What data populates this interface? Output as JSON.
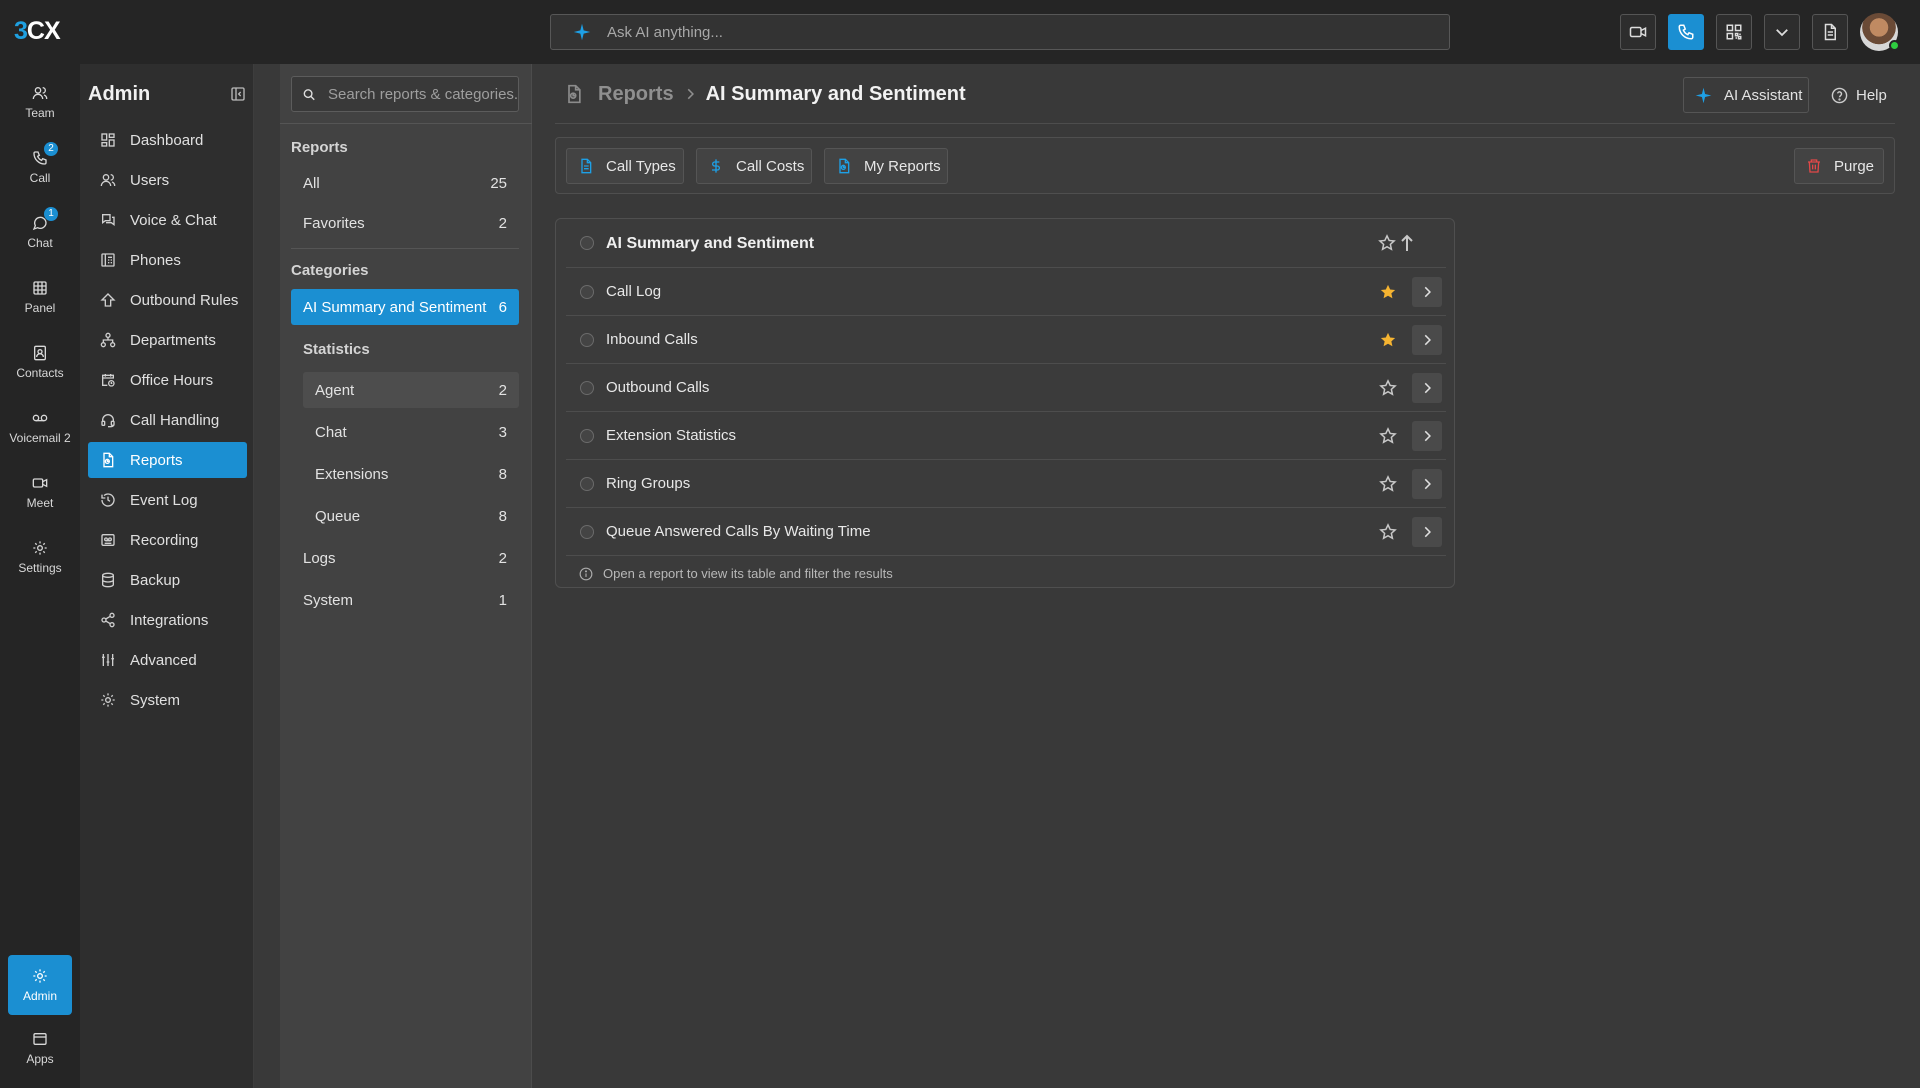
{
  "top": {
    "logo_3": "3",
    "logo_cx": "CX",
    "ai_placeholder": "Ask AI anything...",
    "buttons": [
      "video-icon",
      "phone-icon",
      "qr-code-icon",
      "chevron-down-icon",
      "document-icon"
    ]
  },
  "rail": [
    {
      "label": "Team",
      "icon": "team-icon"
    },
    {
      "label": "Call",
      "icon": "phone-icon",
      "badge": "2"
    },
    {
      "label": "Chat",
      "icon": "chat-icon",
      "badge": "1"
    },
    {
      "label": "Panel",
      "icon": "grid-icon"
    },
    {
      "label": "Contacts",
      "icon": "contacts-icon"
    },
    {
      "label": "Voicemail 2",
      "icon": "voicemail-icon"
    },
    {
      "label": "Meet",
      "icon": "video-icon"
    },
    {
      "label": "Settings",
      "icon": "gear-icon"
    },
    {
      "label": "Admin",
      "icon": "admin-gear-icon"
    },
    {
      "label": "Apps",
      "icon": "apps-icon"
    }
  ],
  "admin": {
    "title": "Admin",
    "items": [
      "Dashboard",
      "Users",
      "Voice & Chat",
      "Phones",
      "Outbound Rules",
      "Departments",
      "Office Hours",
      "Call Handling",
      "Reports",
      "Event Log",
      "Recording",
      "Backup",
      "Integrations",
      "Advanced",
      "System"
    ],
    "active": "Reports"
  },
  "categories": {
    "search_placeholder": "Search reports & categories...",
    "reports_label": "Reports",
    "all": {
      "label": "All",
      "count": "25"
    },
    "favorites": {
      "label": "Favorites",
      "count": "2"
    },
    "categories_label": "Categories",
    "ai_summary": {
      "label": "AI Summary and Sentiment",
      "count": "6"
    },
    "statistics_label": "Statistics",
    "agent": {
      "label": "Agent",
      "count": "2"
    },
    "chat": {
      "label": "Chat",
      "count": "3"
    },
    "extensions": {
      "label": "Extensions",
      "count": "8"
    },
    "queue": {
      "label": "Queue",
      "count": "8"
    },
    "logs": {
      "label": "Logs",
      "count": "2"
    },
    "system": {
      "label": "System",
      "count": "1"
    }
  },
  "main": {
    "breadcrumb_root": "Reports",
    "breadcrumb_current": "AI Summary and Sentiment",
    "ai_assistant": "AI Assistant",
    "help": "Help",
    "toolbar": {
      "call_types": "Call Types",
      "call_costs": "Call Costs",
      "my_reports": "My Reports",
      "purge": "Purge"
    },
    "card_title": "AI Summary and Sentiment",
    "reports": [
      {
        "name": "Call Log",
        "favorite": true
      },
      {
        "name": "Inbound Calls",
        "favorite": true
      },
      {
        "name": "Outbound Calls",
        "favorite": false
      },
      {
        "name": "Extension Statistics",
        "favorite": false
      },
      {
        "name": "Ring Groups",
        "favorite": false
      },
      {
        "name": "Queue Answered Calls By Waiting Time",
        "favorite": false
      }
    ],
    "note": "Open a report to view its table and filter the results"
  },
  "colors": {
    "accent": "#1b8fd2",
    "favorite_star": "#f5b431",
    "purge": "#e24848"
  }
}
